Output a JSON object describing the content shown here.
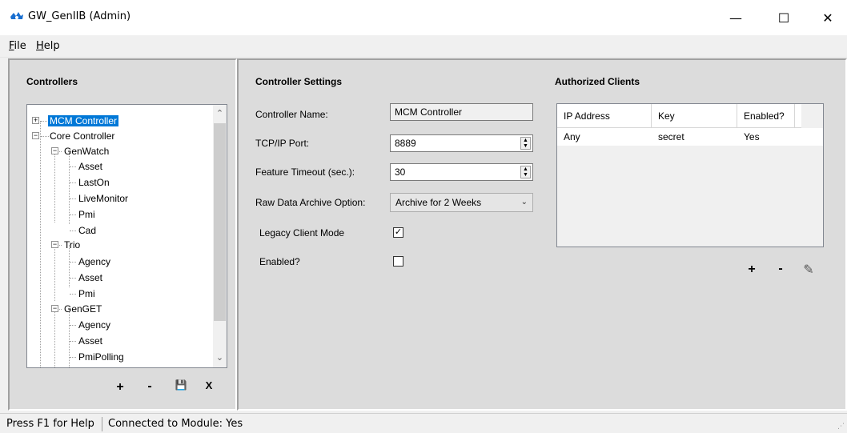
{
  "window": {
    "title": "GW_GenIIB (Admin)",
    "icon": "app-logo-icon",
    "accent_color": "#0078d7",
    "controls": {
      "minimize": "—",
      "maximize": "☐",
      "close": "✕"
    }
  },
  "menu": {
    "file": {
      "mnemonic": "F",
      "rest": "ile"
    },
    "help": {
      "mnemonic": "H",
      "rest": "elp"
    }
  },
  "controllers": {
    "header": "Controllers",
    "tree": [
      {
        "label": "MCM Controller",
        "expander": "+"
      },
      {
        "label": "Core Controller",
        "expander": "−"
      },
      {
        "label": "GenWatch",
        "expander": "−"
      },
      {
        "label": "Asset"
      },
      {
        "label": "LastOn"
      },
      {
        "label": "LiveMonitor"
      },
      {
        "label": "Pmi"
      },
      {
        "label": "Cad"
      },
      {
        "label": "Trio",
        "expander": "−"
      },
      {
        "label": "Agency"
      },
      {
        "label": "Asset"
      },
      {
        "label": "Pmi"
      },
      {
        "label": "GenGET",
        "expander": "−"
      },
      {
        "label": "Agency"
      },
      {
        "label": "Asset"
      },
      {
        "label": "PmiPolling"
      }
    ],
    "selected": "MCM Controller",
    "toolbar": {
      "add": "+",
      "remove": "-",
      "save": "💾",
      "close": "X"
    }
  },
  "settings": {
    "header": "Controller Settings",
    "controller_name_label": "Controller Name:",
    "controller_name_value": "MCM Controller",
    "tcp_port_label": "TCP/IP Port:",
    "tcp_port_value": "8889",
    "feature_timeout_label": "Feature Timeout (sec.):",
    "feature_timeout_value": "30",
    "archive_label": "Raw Data Archive Option:",
    "archive_value": "Archive for 2 Weeks",
    "legacy_label": "Legacy Client Mode",
    "legacy_checked": true,
    "enabled_label": "Enabled?",
    "enabled_checked": false,
    "check_mark": "✓"
  },
  "clients": {
    "header": "Authorized Clients",
    "columns": [
      "IP Address",
      "Key",
      "Enabled?"
    ],
    "rows": [
      [
        "Any",
        "secret",
        "Yes"
      ]
    ],
    "toolbar": {
      "add": "+",
      "remove": "-",
      "edit": "✎"
    }
  },
  "status": {
    "help": "Press F1 for Help",
    "connection": "Connected to Module: Yes",
    "grip": "⋰"
  }
}
